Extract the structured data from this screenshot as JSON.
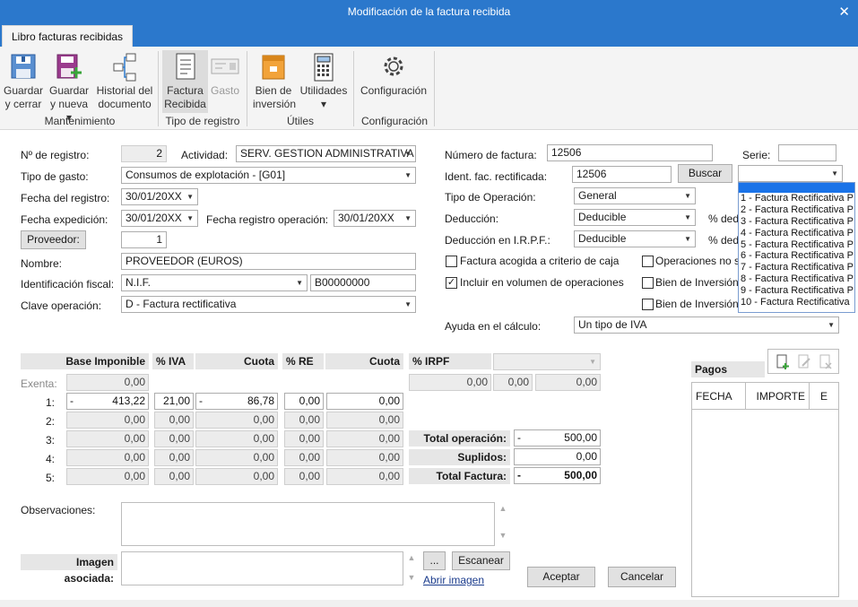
{
  "window": {
    "title": "Modificación de la factura recibida"
  },
  "tabs": [
    {
      "label": "Libro facturas recibidas"
    }
  ],
  "ribbon": {
    "buttons": [
      {
        "line1": "Guardar",
        "line2": "y cerrar"
      },
      {
        "line1": "Guardar",
        "line2": "y nueva ▾"
      },
      {
        "line1": "Historial del",
        "line2": "documento"
      },
      {
        "line1": "Factura",
        "line2": "Recibida"
      },
      {
        "line1": "Gasto",
        "line2": ""
      },
      {
        "line1": "Bien de",
        "line2": "inversión"
      },
      {
        "line1": "Utilidades",
        "line2": "▾"
      },
      {
        "line1": "Configuración",
        "line2": ""
      }
    ],
    "groups": [
      {
        "label": "Mantenimiento"
      },
      {
        "label": "Tipo de registro"
      },
      {
        "label": "Útiles"
      },
      {
        "label": "Configuración"
      }
    ]
  },
  "form": {
    "num_registro_label": "Nº de registro:",
    "num_registro": "2",
    "actividad_label": "Actividad:",
    "actividad": "SERV. GESTION ADMINISTRATIVA",
    "tipo_gasto_label": "Tipo de gasto:",
    "tipo_gasto": "Consumos de explotación - [G01]",
    "fecha_registro_label": "Fecha del registro:",
    "fecha_registro": "30/01/20XX",
    "fecha_expedicion_label": "Fecha expedición:",
    "fecha_expedicion": "30/01/20XX",
    "fecha_reg_op_label": "Fecha registro operación:",
    "fecha_reg_op": "30/01/20XX",
    "proveedor_button": "Proveedor:",
    "proveedor": "1",
    "nombre_label": "Nombre:",
    "nombre": "PROVEEDOR (EUROS)",
    "ident_fiscal_label": "Identificación fiscal:",
    "ident_fiscal_tipo": "N.I.F.",
    "ident_fiscal": "B00000000",
    "clave_op_label": "Clave operación:",
    "clave_op": "D - Factura rectificativa",
    "num_factura_label": "Número de factura:",
    "num_factura": "12506",
    "serie_label": "Serie:",
    "serie": "",
    "ident_rect_label": "Ident. fac. rectificada:",
    "ident_rect": "12506",
    "buscar_button": "Buscar",
    "tipo_op_label": "Tipo de Operación:",
    "tipo_op": "General",
    "deduccion_label": "Deducción:",
    "deduccion": "Deducible",
    "pct_ded_label": "% ded",
    "deduccion_irpf_label": "Deducción en I.R.P.F.:",
    "deduccion_irpf": "Deducible",
    "pct_ded_label2": "% ded",
    "chk_caja_label": "Factura acogida a criterio de caja",
    "chk_ops_label": "Operaciones no su",
    "chk_volumen_label": "Incluir en  volumen de operaciones",
    "chk_bien1_label": "Bien de Inversión",
    "chk_bien2_label": "Bien de Inversión",
    "ayuda_label": "Ayuda en el cálculo:",
    "ayuda": "Un tipo de IVA",
    "observaciones_label": "Observaciones:",
    "imagen_label": "Imagen asociada:",
    "browse_button": "...",
    "escanear_button": "Escanear",
    "abrir_imagen_link": "Abrir imagen",
    "aceptar_button": "Aceptar",
    "cancelar_button": "Cancelar"
  },
  "rect_dropdown": {
    "items": [
      "1 - Factura Rectificativa P",
      "2 - Factura Rectificativa P",
      "3 - Factura Rectificativa P",
      "4 - Factura Rectificativa P",
      "5 - Factura Rectificativa P",
      "6 - Factura Rectificativa P",
      "7 - Factura Rectificativa P",
      "8 - Factura Rectificativa P",
      "9 - Factura Rectificativa P",
      "10 - Factura Rectificativa"
    ]
  },
  "tax_table": {
    "headers": {
      "base": "Base Imponible",
      "iva": "% IVA",
      "cuota": "Cuota",
      "re": "% RE",
      "cuota_re": "Cuota",
      "irpf": "% IRPF"
    },
    "exenta_label": "Exenta:",
    "exenta": "0,00",
    "rows": [
      {
        "label": "1:",
        "base_sign": "-",
        "base": "413,22",
        "iva": "21,00",
        "cuota_sign": "-",
        "cuota": "86,78",
        "re": "0,00",
        "cuota_re": "0,00"
      },
      {
        "label": "2:",
        "base": "0,00",
        "iva": "0,00",
        "cuota": "0,00",
        "re": "0,00",
        "cuota_re": "0,00"
      },
      {
        "label": "3:",
        "base": "0,00",
        "iva": "0,00",
        "cuota": "0,00",
        "re": "0,00",
        "cuota_re": "0,00"
      },
      {
        "label": "4:",
        "base": "0,00",
        "iva": "0,00",
        "cuota": "0,00",
        "re": "0,00",
        "cuota_re": "0,00"
      },
      {
        "label": "5:",
        "base": "0,00",
        "iva": "0,00",
        "cuota": "0,00",
        "re": "0,00",
        "cuota_re": "0,00"
      }
    ],
    "irpf_values": [
      "0,00",
      "0,00",
      "0,00"
    ],
    "total_op_label": "Total operación:",
    "total_op_sign": "-",
    "total_op": "500,00",
    "suplidos_label": "Suplidos:",
    "suplidos": "0,00",
    "total_factura_label": "Total Factura:",
    "total_factura_sign": "-",
    "total_factura": "500,00"
  },
  "pagos": {
    "title": "Pagos",
    "columns": [
      "FECHA",
      "IMPORTE",
      "E"
    ]
  }
}
